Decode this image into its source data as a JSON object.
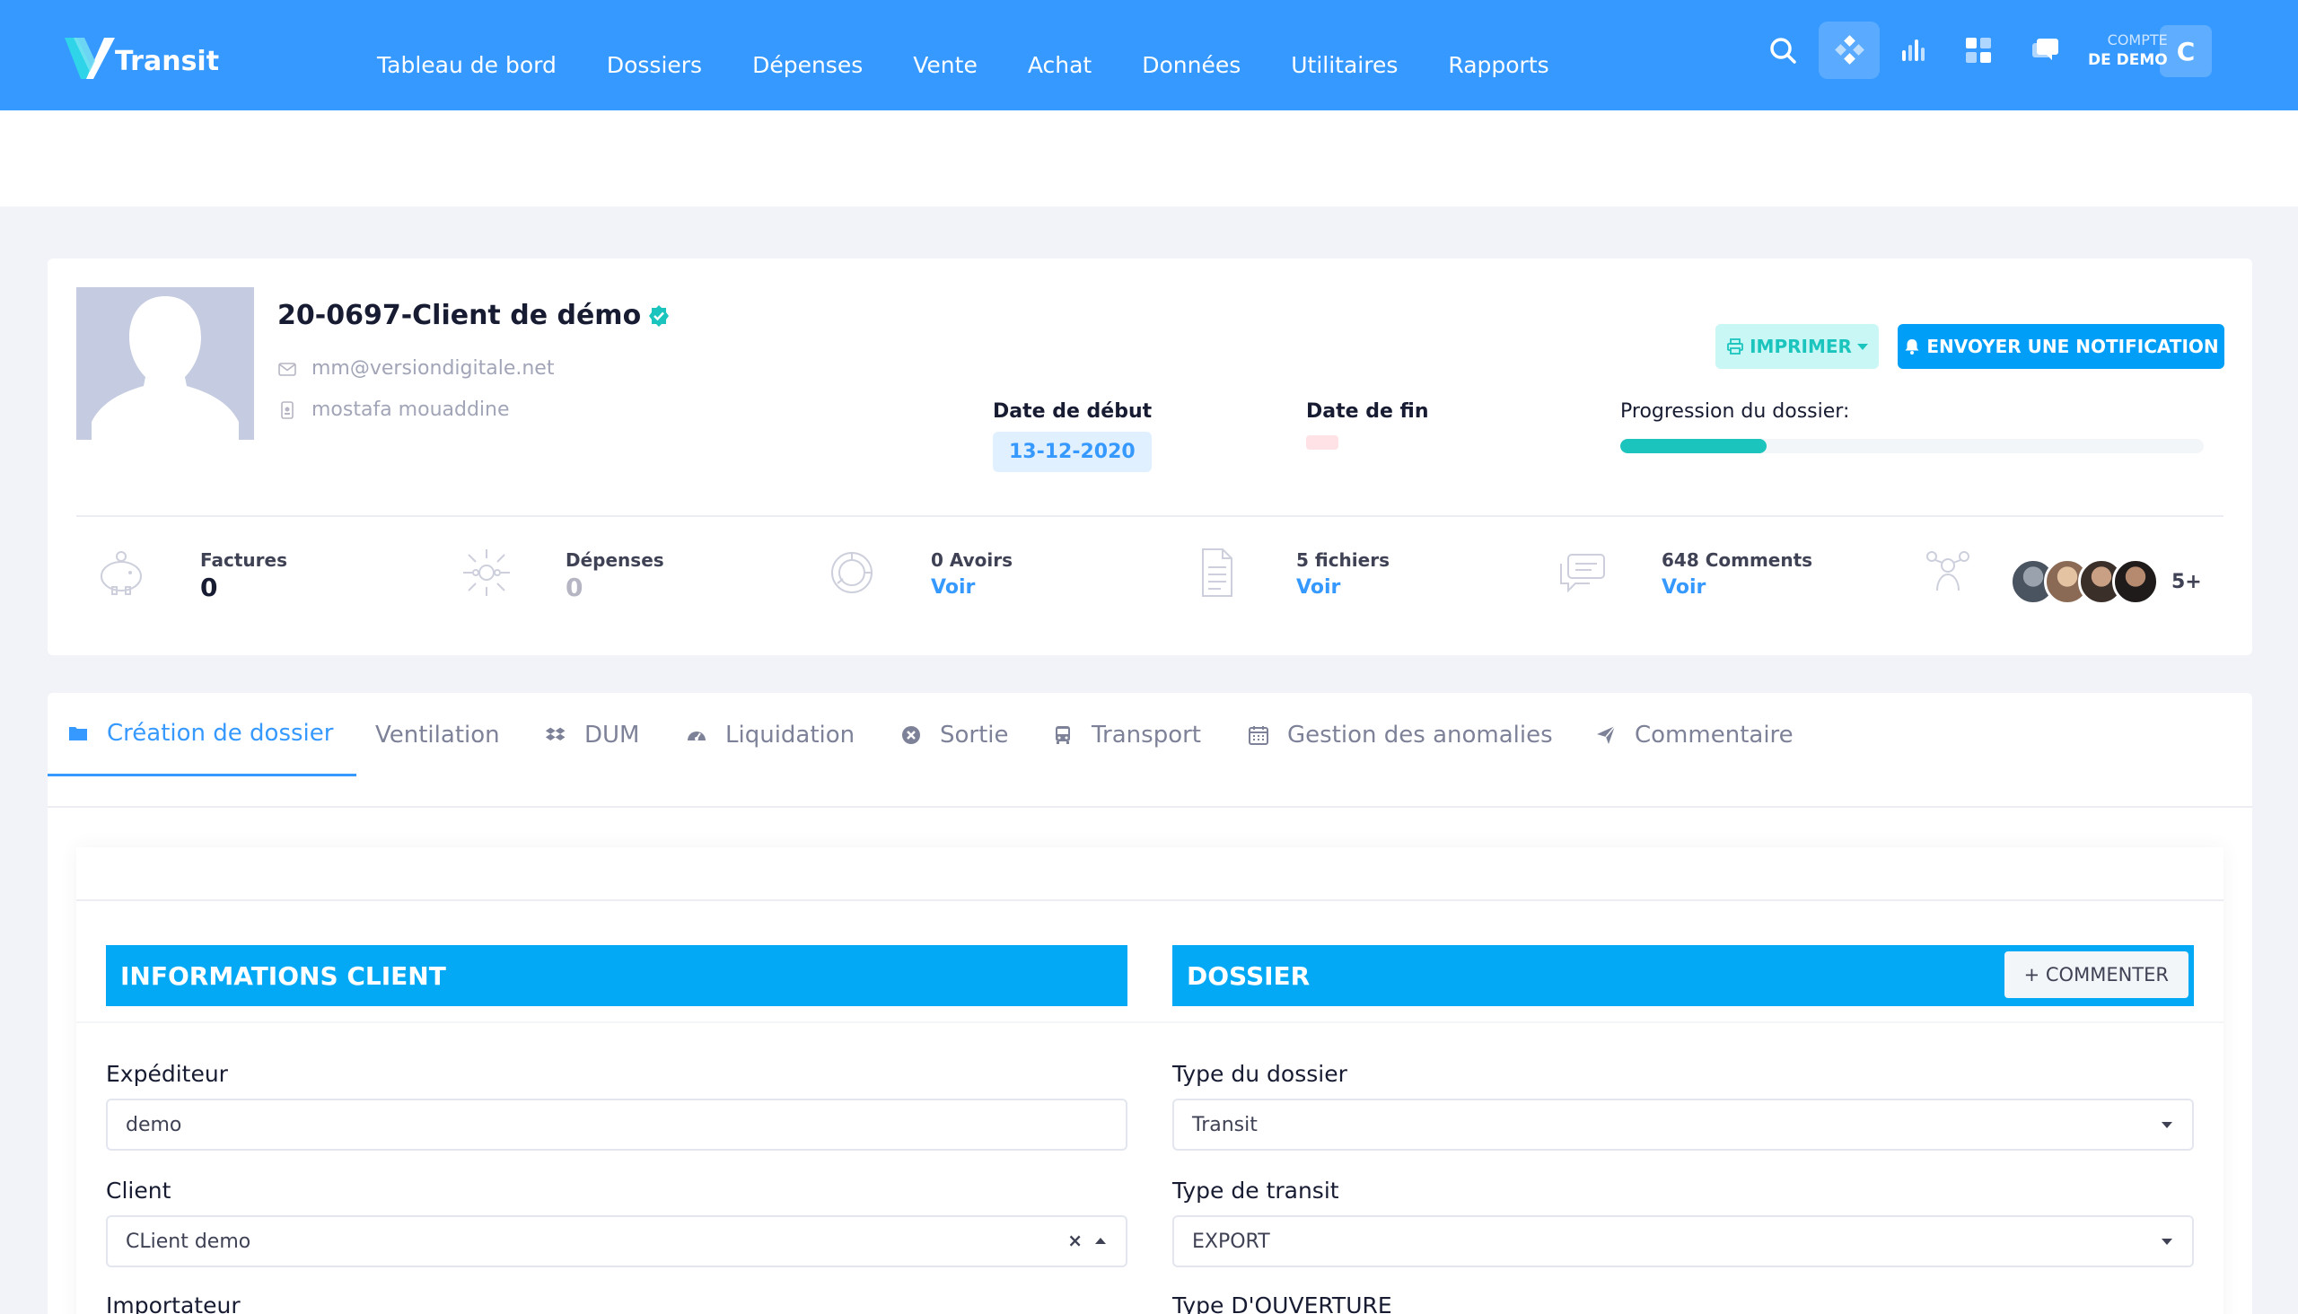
{
  "brand": {
    "name": "Transit"
  },
  "nav": [
    "Tableau de bord",
    "Dossiers",
    "Dépenses",
    "Vente",
    "Achat",
    "Données",
    "Utilitaires",
    "Rapports"
  ],
  "account": {
    "line1": "COMPTE",
    "line2": "DE DEMO",
    "initial": "C"
  },
  "profile": {
    "title": "20-0697-Client de démo",
    "email": "mm@versiondigitale.net",
    "owner": "mostafa mouaddine",
    "start_label": "Date de début",
    "start_value": "13-12-2020",
    "end_label": "Date de fin",
    "progress_label": "Progression du dossier:",
    "progress_fraction": 0.25,
    "print_label": "IMPRIMER",
    "notify_label": "ENVOYER UNE NOTIFICATION"
  },
  "stats": {
    "factures": {
      "title": "Factures",
      "value": "0"
    },
    "depenses": {
      "title": "Dépenses",
      "value": "0"
    },
    "avoirs": {
      "title": "0 Avoirs",
      "link": "Voir"
    },
    "fichiers": {
      "title": "5 fichiers",
      "link": "Voir"
    },
    "comments": {
      "title": "648 Comments",
      "link": "Voir"
    },
    "members_more": "5+"
  },
  "tabs": [
    "Création de dossier",
    "Ventilation",
    "DUM",
    "Liquidation",
    "Sortie",
    "Transport",
    "Gestion des anomalies",
    "Commentaire"
  ],
  "form": {
    "client_section": "INFORMATIONS CLIENT",
    "dossier_section": "DOSSIER",
    "comment_button": "+ COMMENTER",
    "expediteur_label": "Expéditeur",
    "expediteur_value": "demo",
    "client_label": "Client",
    "client_value": "CLient demo",
    "importateur_label": "Importateur",
    "type_dossier_label": "Type du dossier",
    "type_dossier_value": "Transit",
    "type_transit_label": "Type de transit",
    "type_transit_value": "EXPORT",
    "type_ouverture_label": "Type D'OUVERTURE",
    "clear_symbol": "×"
  },
  "colors": {
    "primary": "#3699ff",
    "section": "#03a9f4",
    "success": "#1bc5bd",
    "notify": "#009ef7"
  }
}
